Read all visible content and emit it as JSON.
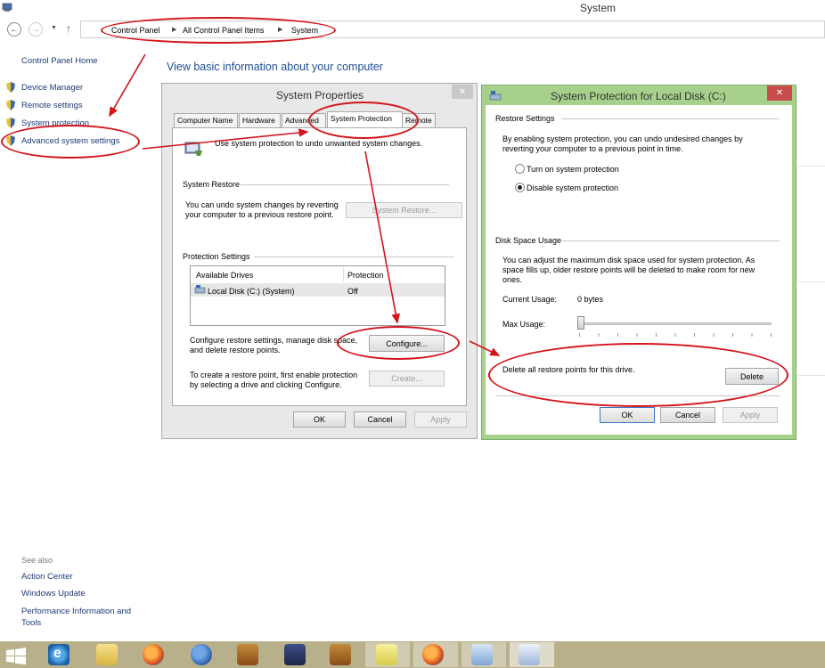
{
  "window": {
    "title": "System"
  },
  "address_bar": {
    "crumbs": [
      "Control Panel",
      "All Control Panel Items",
      "System"
    ]
  },
  "left_nav": {
    "home": "Control Panel Home",
    "items": [
      "Device Manager",
      "Remote settings",
      "System protection",
      "Advanced system settings"
    ],
    "see_also_label": "See also",
    "see_also": [
      "Action Center",
      "Windows Update",
      "Performance Information and",
      "Tools"
    ]
  },
  "main": {
    "heading": "View basic information about your computer"
  },
  "system_properties": {
    "title": "System Properties",
    "close": "✕",
    "tabs": [
      "Computer Name",
      "Hardware",
      "Advanced",
      "System Protection",
      "Remote"
    ],
    "intro": "Use system protection to undo unwanted system changes.",
    "restore_group": "System Restore",
    "restore_text_1": "You can undo system changes by reverting",
    "restore_text_2": "your computer to a previous restore point.",
    "restore_button": "System Restore...",
    "protection_group": "Protection Settings",
    "drives_header": "Available Drives",
    "protection_header": "Protection",
    "drive_name": "Local Disk (C:) (System)",
    "drive_status": "Off",
    "configure_text_1": "Configure restore settings, manage disk space,",
    "configure_text_2": "and delete restore points.",
    "configure_button": "Configure...",
    "create_text_1": "To create a restore point, first enable protection",
    "create_text_2": "by selecting a drive and clicking Configure.",
    "create_button": "Create...",
    "ok": "OK",
    "cancel": "Cancel",
    "apply": "Apply"
  },
  "protection_dialog": {
    "title": "System Protection for Local Disk (C:)",
    "close": "✕",
    "restore_settings_group": "Restore Settings",
    "restore_settings_text_1": "By enabling system protection, you can undo undesired changes by",
    "restore_settings_text_2": "reverting your computer to a previous point in time.",
    "radio_on": "Turn on system protection",
    "radio_off": "Disable system protection",
    "disk_group": "Disk Space Usage",
    "disk_text_1": "You can adjust the maximum disk space used for system protection. As",
    "disk_text_2": "space fills up, older restore points will be deleted to make room for new",
    "disk_text_3": "ones.",
    "current_usage_label": "Current Usage:",
    "current_usage_value": "0 bytes",
    "max_usage_label": "Max Usage:",
    "max_usage_fraction": 0,
    "delete_text": "Delete all restore points for this drive.",
    "delete_button": "Delete",
    "ok": "OK",
    "cancel": "Cancel",
    "apply": "Apply"
  },
  "colors": {
    "annotation": "#d3141c",
    "link": "#1e3b78",
    "dialog_border_green": "#8fbf72",
    "close_red": "#c94c4c",
    "taskbar": "#b8b08a"
  },
  "taskbar_icons": [
    "windows-start-icon",
    "internet-explorer-icon",
    "file-explorer-icon",
    "firefox-icon",
    "thunderbird-icon",
    "archive-icon",
    "media-player-icon",
    "archive-icon",
    "sticky-notes-icon",
    "firefox-icon",
    "control-panel-icon",
    "system-icon"
  ]
}
